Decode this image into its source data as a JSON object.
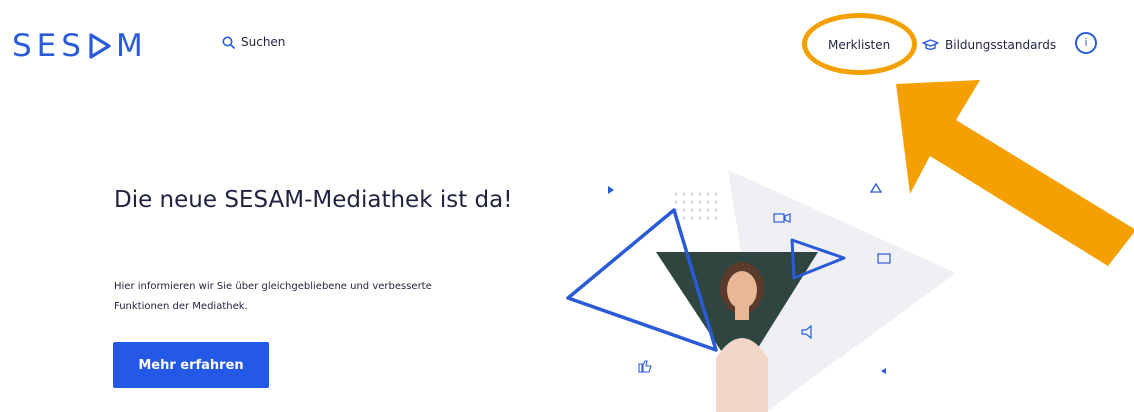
{
  "header": {
    "logo_text_left": "SES",
    "logo_text_right": "M",
    "search_label": "Suchen",
    "merklisten_label": "Merklisten",
    "bildungsstandards_label": "Bildungsstandards",
    "info_label": "i"
  },
  "hero": {
    "title": "Die neue SESAM-Mediathek ist da!",
    "text": "Hier informieren wir Sie über gleichgebliebene und verbesserte Funktionen der Mediathek.",
    "cta_label": "Mehr erfahren"
  },
  "colors": {
    "brand_blue": "#2a5bd7",
    "cta_blue": "#2458e6",
    "annotation_orange": "#f5a000",
    "text_dark": "#1f2340"
  },
  "icons": {
    "search": "magnifier-icon",
    "bildungsstandards": "graduation-cap-icon",
    "info": "info-circle-icon"
  }
}
